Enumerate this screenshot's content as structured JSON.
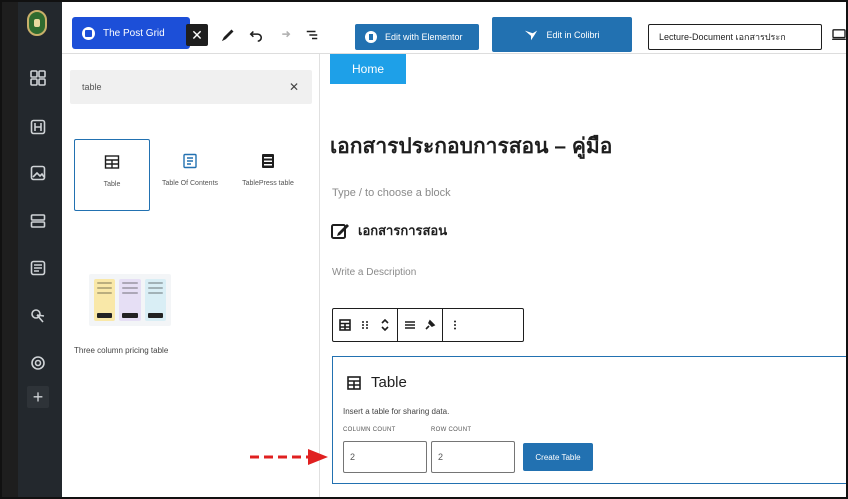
{
  "toolbar": {
    "post_grid_label": "The Post Grid",
    "close_label": "✕",
    "edit_elementor_label": "Edit with Elementor",
    "edit_colibri_label": "Edit in Colibri",
    "document_label": "Lecture-Document เอกสารประก"
  },
  "inserter": {
    "search_value": "table",
    "clear_label": "✕",
    "blocks": [
      {
        "label": "Table",
        "icon": "table-icon",
        "selected": true
      },
      {
        "label": "Table Of Contents",
        "icon": "table-of-contents-icon",
        "selected": false
      },
      {
        "label": "TablePress table",
        "icon": "tablepress-icon",
        "selected": false
      }
    ],
    "pattern_label": "Three column pricing table"
  },
  "canvas": {
    "home_label": "Home",
    "page_title": "เอกสารประกอบการสอน – คู่มือ",
    "block_placeholder": "Type / to choose a block",
    "doc_heading": "เอกสารการสอน",
    "description_placeholder": "Write a Description",
    "table_block": {
      "title": "Table",
      "description": "Insert a table for sharing data.",
      "column_count_label": "COLUMN COUNT",
      "row_count_label": "ROW COUNT",
      "column_count_value": "2",
      "row_count_value": "2",
      "create_label": "Create Table"
    }
  },
  "colors": {
    "accent": "#2271b1",
    "post_grid": "#1c4fd8",
    "home_button": "#1ea0e8",
    "arrow": "#e02020"
  }
}
